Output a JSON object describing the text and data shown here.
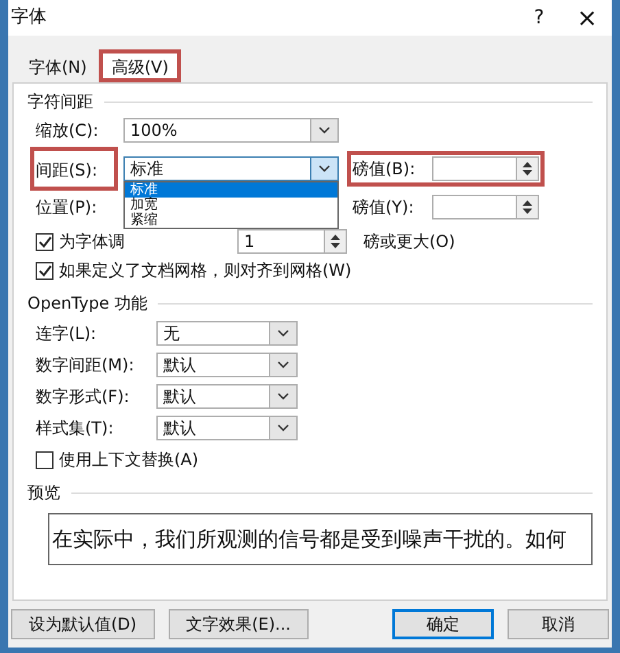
{
  "window": {
    "title": "字体",
    "help": "?",
    "close": "×"
  },
  "tabs": [
    {
      "label": "字体(N)",
      "selected": false,
      "highlighted": false
    },
    {
      "label": "高级(V)",
      "selected": true,
      "highlighted": true
    }
  ],
  "character_spacing": {
    "title": "字符间距",
    "scale": {
      "label": "缩放(C):",
      "value": "100%"
    },
    "spacing": {
      "label": "间距(S):",
      "value": "标准",
      "highlighted": true,
      "expanded": true,
      "options": [
        {
          "label": "标准",
          "selected": true
        },
        {
          "label": "加宽",
          "selected": false
        },
        {
          "label": "紧缩",
          "selected": false
        }
      ]
    },
    "spacing_points": {
      "label": "磅值(B):",
      "highlighted": true
    },
    "position": {
      "label": "位置(P):"
    },
    "position_points": {
      "label": "磅值(Y):"
    },
    "kerning": {
      "label": "为字体调",
      "checked": true,
      "value": "1",
      "suffix": "磅或更大(O)"
    },
    "grid": {
      "label": "如果定义了文档网格，则对齐到网格(W)",
      "checked": true
    }
  },
  "opentype": {
    "title": "OpenType 功能",
    "fields": [
      {
        "label": "连字(L):",
        "value": "无"
      },
      {
        "label": "数字间距(M):",
        "value": "默认"
      },
      {
        "label": "数字形式(F):",
        "value": "默认"
      },
      {
        "label": "样式集(T):",
        "value": "默认"
      }
    ],
    "contextual": {
      "label": "使用上下文替换(A)",
      "checked": false
    }
  },
  "preview": {
    "title": "预览",
    "text": "在实际中，我们所观测的信号都是受到噪声干扰的。如何"
  },
  "buttons": [
    {
      "label": "设为默认值(D)",
      "default": false
    },
    {
      "label": "文字效果(E)...",
      "default": false
    },
    {
      "label": "确定",
      "default": true
    },
    {
      "label": "取消",
      "default": false
    }
  ]
}
